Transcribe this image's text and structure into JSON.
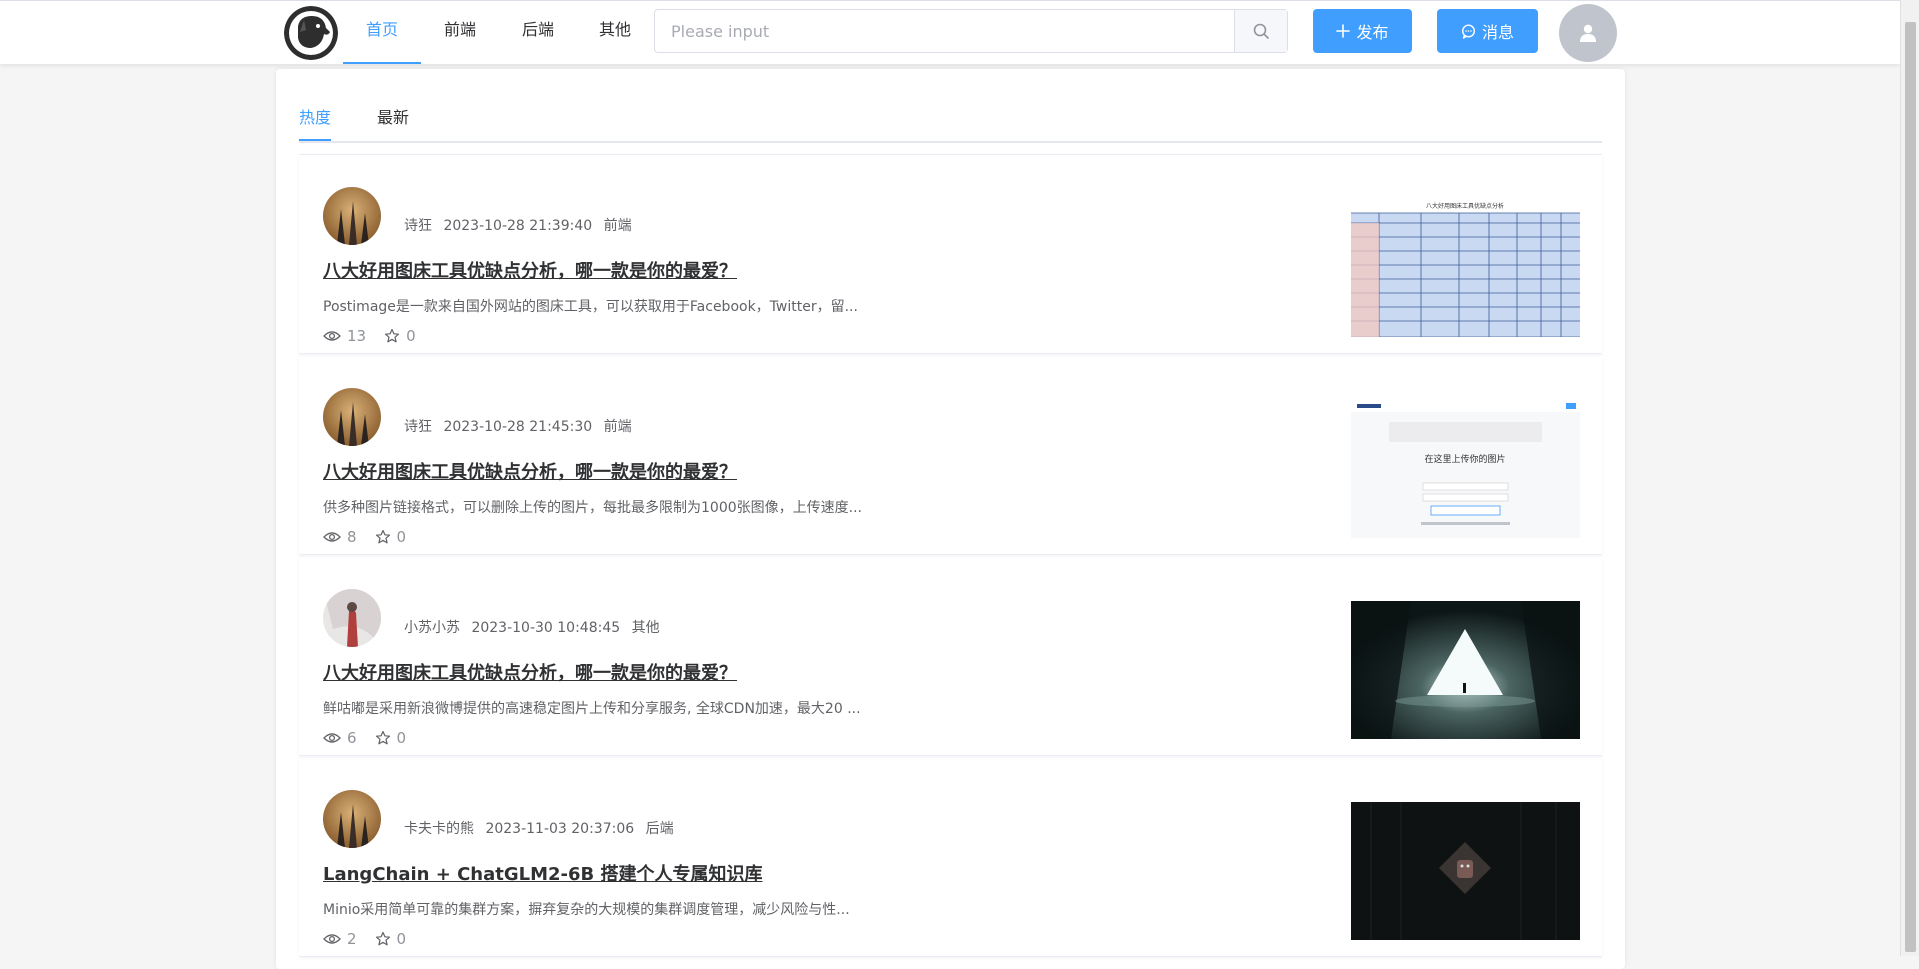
{
  "nav": {
    "items": [
      {
        "label": "首页",
        "active": true
      },
      {
        "label": "前端",
        "active": false
      },
      {
        "label": "后端",
        "active": false
      },
      {
        "label": "其他",
        "active": false
      }
    ],
    "search": {
      "placeholder": "Please input",
      "value": ""
    },
    "publish_label": "发布",
    "message_label": "消息"
  },
  "tabs": [
    {
      "label": "热度",
      "active": true
    },
    {
      "label": "最新",
      "active": false
    }
  ],
  "articles": [
    {
      "author": "诗狂",
      "date": "2023-10-28 21:39:40",
      "category": "前端",
      "title": "八大好用图床工具优缺点分析，哪一款是你的最爱？",
      "summary": "Postimage是一款来自国外网站的图床工具，可以获取用于Facebook，Twitter，留...",
      "views": "13",
      "stars": "0",
      "thumb_text": "八大好用图床工具优缺点分析"
    },
    {
      "author": "诗狂",
      "date": "2023-10-28 21:45:30",
      "category": "前端",
      "title": "八大好用图床工具优缺点分析，哪一款是你的最爱？",
      "summary": "供多种图片链接格式，可以删除上传的图片，每批最多限制为1000张图像，上传速度...",
      "views": "8",
      "stars": "0",
      "thumb_text": "在这里上传你的图片"
    },
    {
      "author": "小苏小苏",
      "date": "2023-10-30 10:48:45",
      "category": "其他",
      "title": "八大好用图床工具优缺点分析，哪一款是你的最爱？",
      "summary": "鲜咕嘟是采用新浪微博提供的高速稳定图片上传和分享服务, 全球CDN加速，最大20 ...",
      "views": "6",
      "stars": "0",
      "thumb_text": ""
    },
    {
      "author": "卡夫卡的熊",
      "date": "2023-11-03 20:37:06",
      "category": "后端",
      "title": "LangChain + ChatGLM2-6B 搭建个人专属知识库",
      "summary": "Minio采用简单可靠的集群方案，摒弃复杂的大规模的集群调度管理，减少风险与性...",
      "views": "2",
      "stars": "0",
      "thumb_text": ""
    }
  ],
  "colors": {
    "primary": "#409eff",
    "text": "#303133",
    "muted": "#909399"
  }
}
